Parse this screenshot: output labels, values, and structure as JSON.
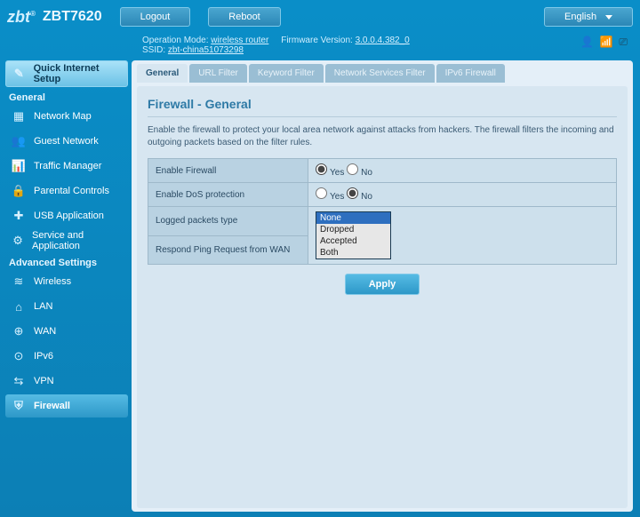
{
  "brand": "zbt",
  "model": "ZBT7620",
  "header": {
    "logout": "Logout",
    "reboot": "Reboot",
    "language": "English"
  },
  "meta": {
    "opmode_label": "Operation Mode:",
    "opmode_value": "wireless router",
    "fw_label": "Firmware Version:",
    "fw_value": "3.0.0.4.382_0",
    "ssid_label": "SSID:",
    "ssid_value": "zbt-china51073298"
  },
  "sidebar": {
    "quick": "Quick Internet Setup",
    "cat_general": "General",
    "cat_advanced": "Advanced Settings",
    "general": [
      {
        "icon": "network-map-icon",
        "label": "Network Map"
      },
      {
        "icon": "guest-network-icon",
        "label": "Guest Network"
      },
      {
        "icon": "traffic-icon",
        "label": "Traffic Manager"
      },
      {
        "icon": "parental-icon",
        "label": "Parental Controls"
      },
      {
        "icon": "usb-icon",
        "label": "USB Application"
      },
      {
        "icon": "service-icon",
        "label": "Service and Application"
      }
    ],
    "advanced": [
      {
        "icon": "wireless-icon",
        "label": "Wireless"
      },
      {
        "icon": "lan-icon",
        "label": "LAN"
      },
      {
        "icon": "wan-icon",
        "label": "WAN"
      },
      {
        "icon": "ipv6-icon",
        "label": "IPv6"
      },
      {
        "icon": "vpn-icon",
        "label": "VPN"
      },
      {
        "icon": "firewall-icon",
        "label": "Firewall",
        "active": true
      }
    ]
  },
  "tabs": [
    "General",
    "URL Filter",
    "Keyword Filter",
    "Network Services Filter",
    "IPv6 Firewall"
  ],
  "page": {
    "title": "Firewall - General",
    "desc": "Enable the firewall to protect your local area network against attacks from hackers. The firewall filters the incoming and outgoing packets based on the filter rules.",
    "rows": {
      "enable_fw": "Enable Firewall",
      "enable_dos": "Enable DoS protection",
      "logged": "Logged packets type",
      "ping_wan": "Respond Ping Request from WAN"
    },
    "yes": "Yes",
    "no": "No",
    "opts": [
      "None",
      "Dropped",
      "Accepted",
      "Both"
    ],
    "apply": "Apply"
  },
  "icons": {
    "network-map-icon": "▦",
    "guest-network-icon": "👥",
    "traffic-icon": "📊",
    "parental-icon": "🔒",
    "usb-icon": "✚",
    "service-icon": "⚙",
    "wireless-icon": "≋",
    "lan-icon": "⌂",
    "wan-icon": "⊕",
    "ipv6-icon": "⊙",
    "vpn-icon": "⇆",
    "firewall-icon": "⛨",
    "wand-icon": "✎"
  }
}
